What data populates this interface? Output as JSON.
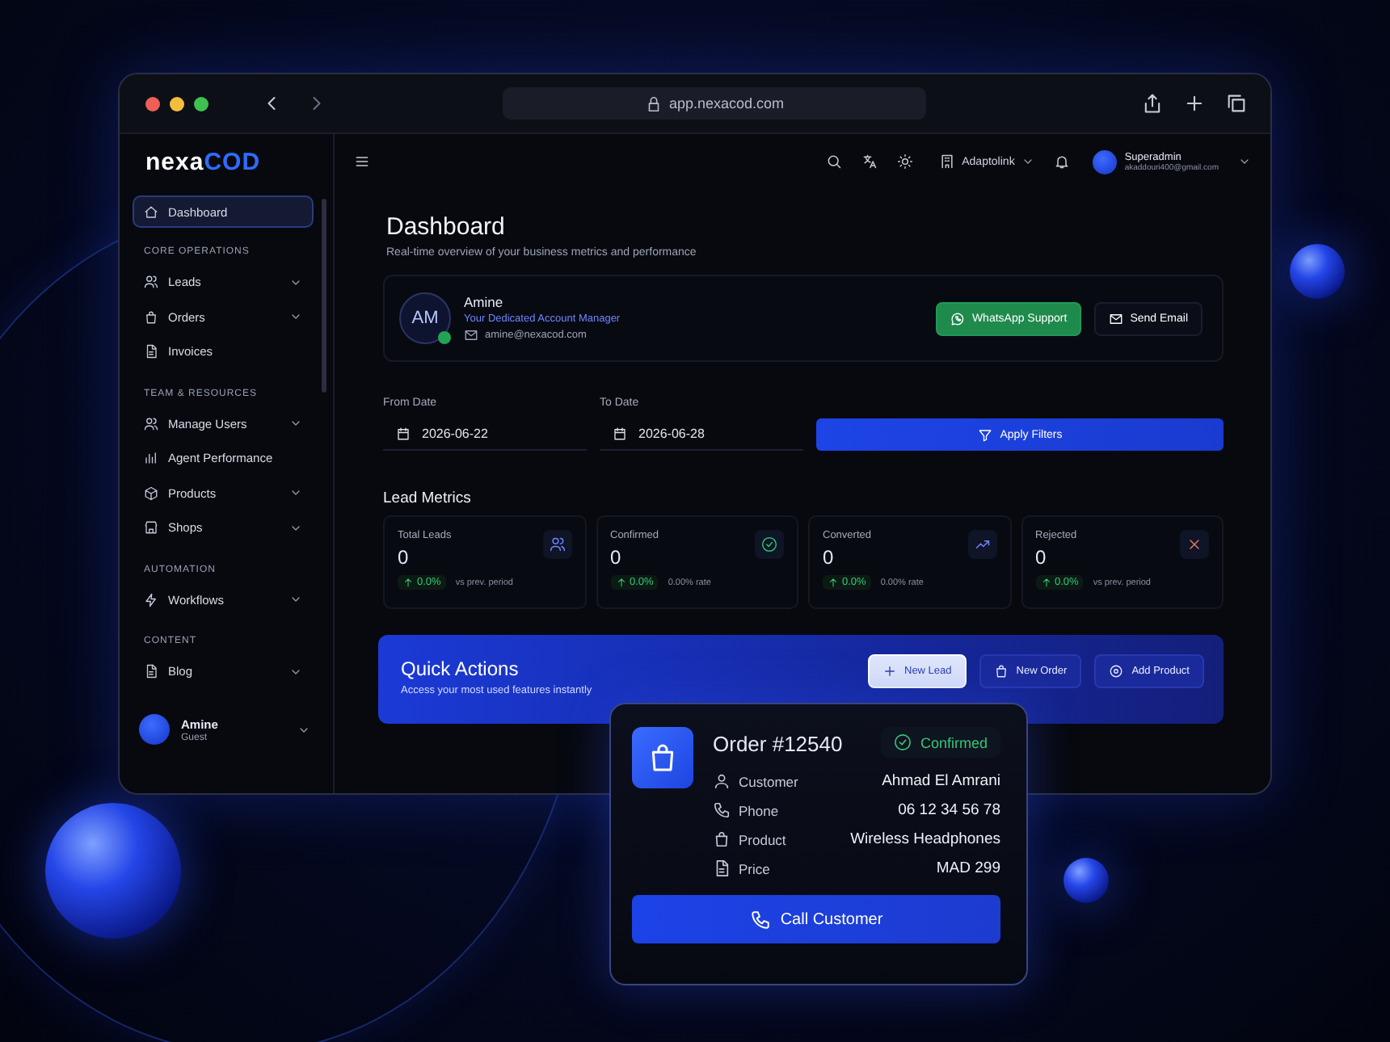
{
  "browser": {
    "url": "app.nexacod.com"
  },
  "logo": {
    "text": "nexa",
    "accent": "COD"
  },
  "sidebar": {
    "sections": [
      {
        "items": [
          {
            "label": "Dashboard",
            "selected": true,
            "expandable": false
          }
        ]
      },
      {
        "title": "CORE OPERATIONS",
        "items": [
          {
            "label": "Leads",
            "selected": false,
            "expandable": true
          },
          {
            "label": "Orders",
            "selected": false,
            "expandable": true
          },
          {
            "label": "Invoices",
            "selected": false,
            "expandable": false
          }
        ]
      },
      {
        "title": "TEAM & RESOURCES",
        "items": [
          {
            "label": "Manage Users",
            "selected": false,
            "expandable": true
          },
          {
            "label": "Agent Performance",
            "selected": false,
            "expandable": false
          },
          {
            "label": "Products",
            "selected": false,
            "expandable": true
          },
          {
            "label": "Shops",
            "selected": false,
            "expandable": true
          }
        ]
      },
      {
        "title": "AUTOMATION",
        "items": [
          {
            "label": "Workflows",
            "selected": false,
            "expandable": true
          }
        ]
      },
      {
        "title": "CONTENT",
        "items": [
          {
            "label": "Blog",
            "selected": false,
            "expandable": true
          }
        ]
      }
    ],
    "user": {
      "name": "Amine",
      "role": "Guest"
    }
  },
  "header": {
    "workspace": "Adaptolink",
    "user": {
      "name": "Superadmin",
      "email": "akaddouri400@gmail.com"
    }
  },
  "page": {
    "title": "Dashboard",
    "subtitle": "Real-time overview of your business metrics and performance"
  },
  "account_manager": {
    "initials": "AM",
    "online": true,
    "name": "Amine",
    "role": "Your Dedicated Account Manager",
    "email": "amine@nexacod.com",
    "buttons": [
      {
        "label": "WhatsApp Support",
        "kind": "whatsapp"
      },
      {
        "label": "Send Email",
        "kind": "email"
      }
    ]
  },
  "filters": {
    "from": {
      "label": "From Date",
      "value": "2026-06-22"
    },
    "to": {
      "label": "To Date",
      "value": "2026-06-28"
    },
    "apply": "Apply Filters"
  },
  "lead_metrics": {
    "title": "Lead Metrics",
    "cards": [
      {
        "label": "Total Leads",
        "value": "0",
        "change": "0.0%",
        "note": "vs prev. period"
      },
      {
        "label": "Confirmed",
        "value": "0",
        "change": "0.0%",
        "note": "0.00% rate"
      },
      {
        "label": "Converted",
        "value": "0",
        "change": "0.0%",
        "note": "0.00% rate"
      },
      {
        "label": "Rejected",
        "value": "0",
        "change": "0.0%",
        "note": "vs prev. period"
      }
    ]
  },
  "quick_actions": {
    "title": "Quick Actions",
    "subtitle": "Access your most used features instantly",
    "buttons": [
      {
        "label": "New Lead",
        "kind": "primary"
      },
      {
        "label": "New Order",
        "kind": "secondary"
      },
      {
        "label": "Add Product",
        "kind": "secondary"
      }
    ]
  },
  "order_card": {
    "title": "Order #12540",
    "status": "Confirmed",
    "rows": [
      {
        "label": "Customer",
        "value": "Ahmad El Amrani"
      },
      {
        "label": "Phone",
        "value": "06 12 34 56 78"
      },
      {
        "label": "Product",
        "value": "Wireless Headphones"
      },
      {
        "label": "Price",
        "value": "MAD 299"
      }
    ],
    "action": "Call Customer"
  }
}
